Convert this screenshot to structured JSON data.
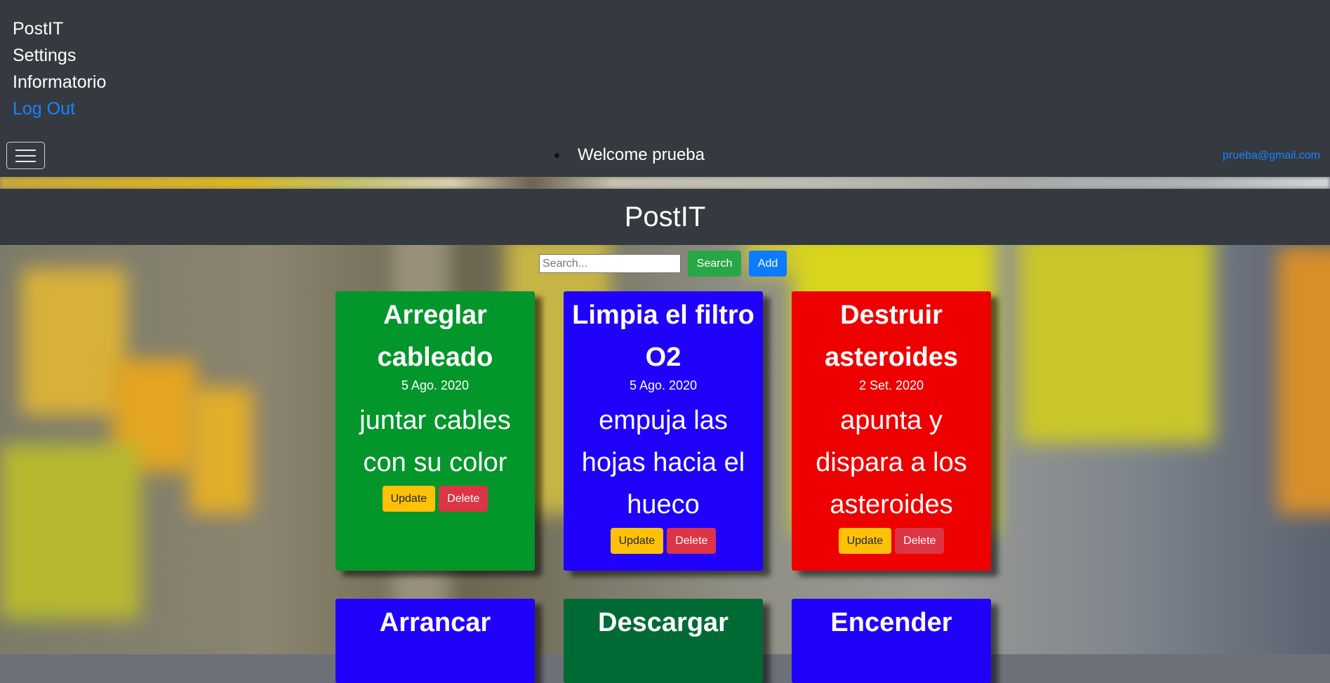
{
  "nav": {
    "items": [
      {
        "label": "PostIT"
      },
      {
        "label": "Settings"
      },
      {
        "label": "Informatorio"
      },
      {
        "label": "Log Out"
      }
    ],
    "welcome": "Welcome prueba",
    "email": "prueba@gmail.com",
    "toggler_icon": "hamburger-icon"
  },
  "header": {
    "title": "PostIT"
  },
  "search": {
    "placeholder": "Search...",
    "value": "",
    "search_label": "Search",
    "add_label": "Add"
  },
  "colors": {
    "green": "#02962b",
    "blue": "#2002fa",
    "red": "#ef0000",
    "dark_green": "#006a35",
    "navbar": "#343a40",
    "link": "#1b82ff"
  },
  "cards": [
    {
      "title": "Arreglar cableado",
      "date": "5 Ago. 2020",
      "body": "juntar cables con su color",
      "color": "#02962b",
      "update_label": "Update",
      "delete_label": "Delete"
    },
    {
      "title": "Limpia el filtro O2",
      "date": "5 Ago. 2020",
      "body": "empuja las hojas hacia el hueco",
      "color": "#2002fa",
      "update_label": "Update",
      "delete_label": "Delete"
    },
    {
      "title": "Destruir asteroides",
      "date": "2 Set. 2020",
      "body": "apunta y dispara a los asteroides",
      "color": "#ef0000",
      "update_label": "Update",
      "delete_label": "Delete"
    },
    {
      "title": "Arrancar",
      "color": "#2002fa"
    },
    {
      "title": "Descargar",
      "color": "#006a35"
    },
    {
      "title": "Encender",
      "color": "#2002fa"
    }
  ]
}
